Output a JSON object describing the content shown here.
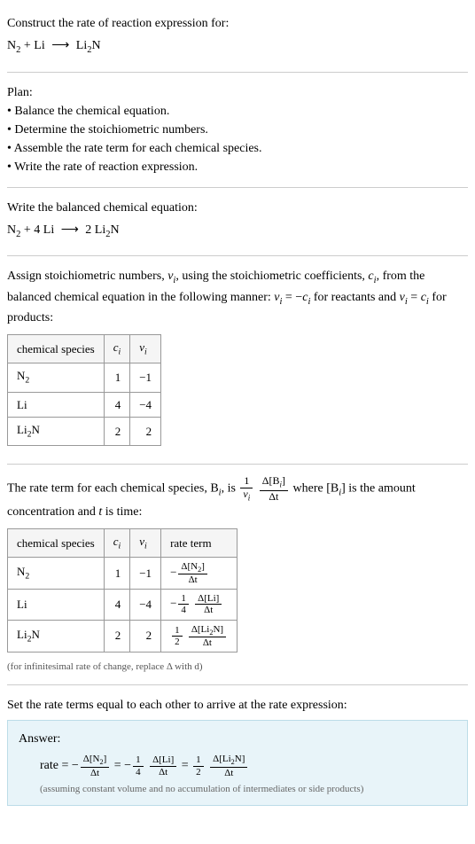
{
  "prompt": {
    "line1": "Construct the rate of reaction expression for:",
    "eq_lhs1": "N",
    "eq_sub1": "2",
    "eq_plus": " + Li ",
    "eq_arrow": "⟶",
    "eq_rhs1": " Li",
    "eq_sub2": "2",
    "eq_rhs2": "N"
  },
  "plan": {
    "title": "Plan:",
    "b1": "• Balance the chemical equation.",
    "b2": "• Determine the stoichiometric numbers.",
    "b3": "• Assemble the rate term for each chemical species.",
    "b4": "• Write the rate of reaction expression."
  },
  "balanced": {
    "title": "Write the balanced chemical equation:",
    "t1": "N",
    "s1": "2",
    "t2": " + 4 Li ",
    "arrow": "⟶",
    "t3": " 2 Li",
    "s2": "2",
    "t4": "N"
  },
  "assign": {
    "p1": "Assign stoichiometric numbers, ",
    "vi": "ν",
    "isub": "i",
    "p2": ", using the stoichiometric coefficients, ",
    "ci": "c",
    "p3": ", from the balanced chemical equation in the following manner: ",
    "eq1a": "ν",
    "eq1b": " = −",
    "eq1c": "c",
    "p4": " for reactants and ",
    "eq2a": "ν",
    "eq2b": " = ",
    "eq2c": "c",
    "p5": " for products:"
  },
  "table1": {
    "h1": "chemical species",
    "h2": "c",
    "h2sub": "i",
    "h3": "ν",
    "h3sub": "i",
    "r1c1a": "N",
    "r1c1b": "2",
    "r1c2": "1",
    "r1c3": "−1",
    "r2c1": "Li",
    "r2c2": "4",
    "r2c3": "−4",
    "r3c1a": "Li",
    "r3c1b": "2",
    "r3c1c": "N",
    "r3c2": "2",
    "r3c3": "2"
  },
  "rateterm": {
    "p1": "The rate term for each chemical species, B",
    "isub": "i",
    "p2": ", is ",
    "f1top": "1",
    "f1bota": "ν",
    "f1botb": "i",
    "f2topa": "Δ[B",
    "f2topb": "i",
    "f2topc": "]",
    "f2bot": "Δt",
    "p3": " where [B",
    "p4": "] is the amount concentration and ",
    "tvar": "t",
    "p5": " is time:"
  },
  "table2": {
    "h1": "chemical species",
    "h2": "c",
    "h2sub": "i",
    "h3": "ν",
    "h3sub": "i",
    "h4": "rate term",
    "r1c1a": "N",
    "r1c1b": "2",
    "r1c2": "1",
    "r1c3": "−1",
    "r1_neg": "−",
    "r1_ftopa": "Δ[N",
    "r1_ftopb": "2",
    "r1_ftopc": "]",
    "r1_fbot": "Δt",
    "r2c1": "Li",
    "r2c2": "4",
    "r2c3": "−4",
    "r2_neg": "−",
    "r2_f1top": "1",
    "r2_f1bot": "4",
    "r2_f2top": "Δ[Li]",
    "r2_f2bot": "Δt",
    "r3c1a": "Li",
    "r3c1b": "2",
    "r3c1c": "N",
    "r3c2": "2",
    "r3c3": "2",
    "r3_f1top": "1",
    "r3_f1bot": "2",
    "r3_f2topa": "Δ[Li",
    "r3_f2topb": "2",
    "r3_f2topc": "N]",
    "r3_f2bot": "Δt"
  },
  "note": "(for infinitesimal rate of change, replace Δ with d)",
  "setequal": "Set the rate terms equal to each other to arrive at the rate expression:",
  "answer": {
    "label": "Answer:",
    "rate": "rate = −",
    "t1a": "Δ[N",
    "t1b": "2",
    "t1c": "]",
    "t1bot": "Δt",
    "eq1": " = −",
    "f2top": "1",
    "f2bot": "4",
    "t2top": "Δ[Li]",
    "t2bot": "Δt",
    "eq2": " = ",
    "f3top": "1",
    "f3bot": "2",
    "t3a": "Δ[Li",
    "t3b": "2",
    "t3c": "N]",
    "t3bot": "Δt",
    "assume": "(assuming constant volume and no accumulation of intermediates or side products)"
  },
  "chart_data": {
    "type": "table",
    "tables": [
      {
        "title": "Stoichiometric numbers",
        "columns": [
          "chemical species",
          "c_i",
          "ν_i"
        ],
        "rows": [
          [
            "N2",
            1,
            -1
          ],
          [
            "Li",
            4,
            -4
          ],
          [
            "Li2N",
            2,
            2
          ]
        ]
      },
      {
        "title": "Rate terms",
        "columns": [
          "chemical species",
          "c_i",
          "ν_i",
          "rate term"
        ],
        "rows": [
          [
            "N2",
            1,
            -1,
            "-Δ[N2]/Δt"
          ],
          [
            "Li",
            4,
            -4,
            "-(1/4) Δ[Li]/Δt"
          ],
          [
            "Li2N",
            2,
            2,
            "(1/2) Δ[Li2N]/Δt"
          ]
        ]
      }
    ]
  }
}
